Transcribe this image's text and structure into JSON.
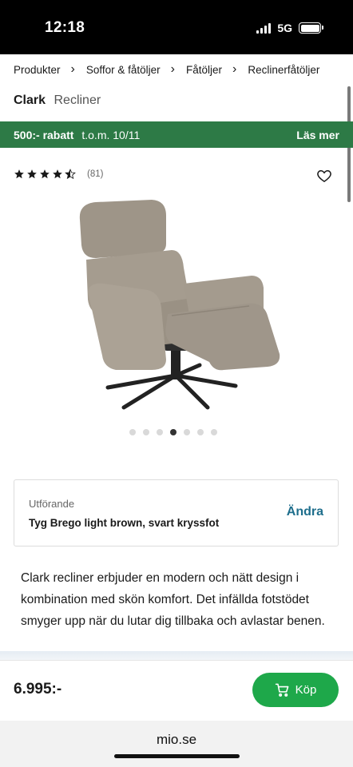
{
  "status_bar": {
    "time": "12:18",
    "network": "5G",
    "icons": [
      "signal-icon",
      "battery-icon"
    ]
  },
  "breadcrumb": [
    {
      "label": "Produkter"
    },
    {
      "label": "Soffor & fåtöljer"
    },
    {
      "label": "Fåtöljer"
    },
    {
      "label": "Reclinerfåtöljer"
    }
  ],
  "product": {
    "brand": "Clark",
    "model": "Recliner",
    "rating": 4.5,
    "review_count": "(81)",
    "image_count": 7,
    "active_image": 4,
    "description": "Clark recliner erbjuder en modern och nätt design i kombination med skön komfort. Det infällda fotstödet smyger upp när du lutar dig tillbaka och avlastar benen."
  },
  "promo": {
    "text": "500:- rabatt",
    "date": "t.o.m. 10/11",
    "link": "Läs mer",
    "color": "#2d7a46"
  },
  "variant": {
    "label": "Utförande",
    "value": "Tyg Brego light brown, svart kryssfot",
    "change_label": "Ändra"
  },
  "purchase": {
    "price": "6.995:-",
    "buy_label": "Köp",
    "button_color": "#1ea84a"
  },
  "browser": {
    "url": "mio.se"
  }
}
